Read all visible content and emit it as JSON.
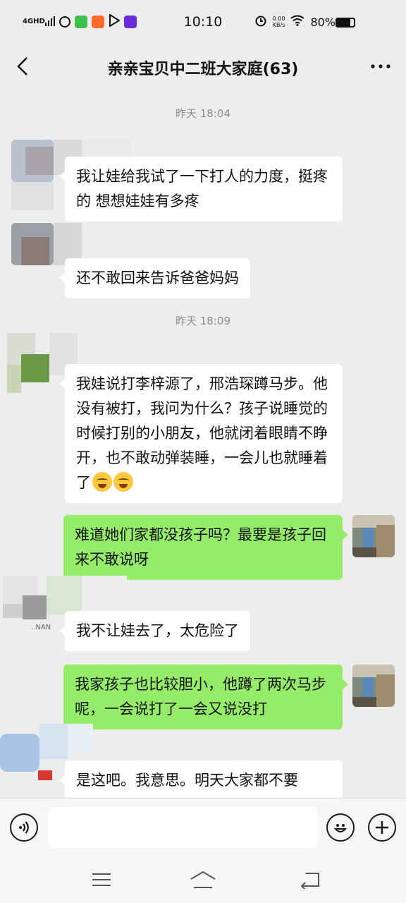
{
  "status_bar": {
    "network": "4GHD",
    "time": "10:10",
    "speed_value": "0.00",
    "speed_unit": "KB/s",
    "battery": "80%"
  },
  "header": {
    "title": "亲亲宝贝中二班大家庭(63)"
  },
  "messages": {
    "t1": "昨天 18:04",
    "m1": "我让娃给我试了一下打人的力度，挺疼的 想想娃娃有多疼",
    "m2": "还不敢回来告诉爸爸妈妈",
    "t2": "昨天 18:09",
    "m3": "我娃说打李梓源了，邢浩琛蹲马步。他没有被打，我问为什么？孩子说睡觉的时候打别的小朋友，他就闭着眼睛不睁开，也不敢动弹装睡，一会儿也就睡着了",
    "m4": "难道她们家都没孩子吗？最要是孩子回来不敢说呀",
    "m5_sender": "..NAN",
    "m5": "我不让娃去了，太危险了",
    "m6": "我家孩子也比较胆小，他蹲了两次马步呢，一会说打了一会又说没打",
    "m7": "是这吧。我意思。明天大家都不要"
  },
  "input": {
    "value": ""
  },
  "icons": {
    "back": "chevron-left-icon",
    "more": "more-dots-icon",
    "voice": "voice-icon",
    "emoji": "emoji-icon",
    "add": "plus-icon"
  },
  "colors": {
    "background": "#ededed",
    "incoming_bubble": "#ffffff",
    "outgoing_bubble": "#95ec69"
  }
}
